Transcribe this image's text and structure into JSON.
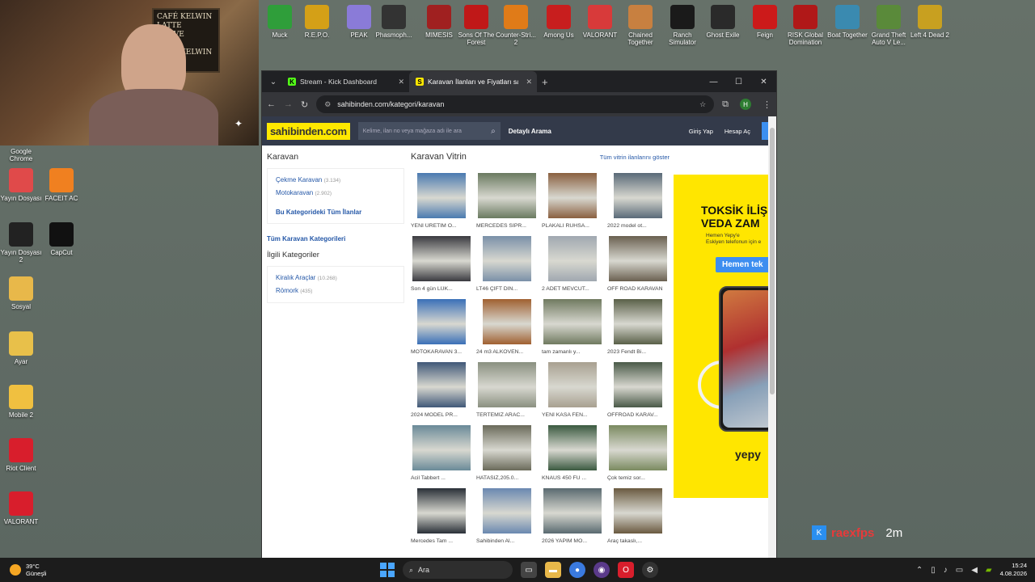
{
  "webcam": {
    "sign_text": "CAFÉ KELWIN\nLATTE\nKAHVE\nSIMIT\nCAFÉ KELWIN"
  },
  "desktop_top_icons": [
    {
      "label": "Muck",
      "color": "#2f9e3a"
    },
    {
      "label": "R.E.P.O.",
      "color": "#d4a017"
    },
    {
      "label": "PEAK",
      "color": "#8a7bd8"
    },
    {
      "label": "Phasmoph...",
      "color": "#333333"
    },
    {
      "label": "MIMESIS",
      "color": "#a02020"
    },
    {
      "label": "Sons Of The Forest",
      "color": "#c01818"
    },
    {
      "label": "Counter-Stri... 2",
      "color": "#e07b18"
    },
    {
      "label": "Among Us",
      "color": "#c81e1e"
    },
    {
      "label": "VALORANT",
      "color": "#d83a3a"
    },
    {
      "label": "Chained Together",
      "color": "#c88040"
    },
    {
      "label": "Ranch Simulator",
      "color": "#1a1a1a"
    },
    {
      "label": "Ghost Exile",
      "color": "#2a2a2a"
    },
    {
      "label": "Feign",
      "color": "#cc1a1a"
    },
    {
      "label": "RISK Global Domination",
      "color": "#b01818"
    },
    {
      "label": "Boat Together",
      "color": "#3a8ab0"
    },
    {
      "label": "Grand Theft Auto V Le...",
      "color": "#5a8a3a"
    },
    {
      "label": "Left 4 Dead 2",
      "color": "#c8a020"
    }
  ],
  "desktop_left_icons": [
    {
      "label": "Google Chrome",
      "color": "#3a7ae0"
    },
    {
      "label": "Yayın Dosyası",
      "color": "#e04a4a"
    },
    {
      "label": "FACEIT AC",
      "color": "#f08020"
    },
    {
      "label": "Yayın Dosyası 2",
      "color": "#222222"
    },
    {
      "label": "CapCut",
      "color": "#111111"
    },
    {
      "label": "Sosyal",
      "color": "#e8b84a"
    },
    {
      "label": "Ayar",
      "color": "#e8c04a"
    },
    {
      "label": "Mobile 2",
      "color": "#f0c040"
    },
    {
      "label": "Riot Client",
      "color": "#d81e2c"
    },
    {
      "label": "VALORANT",
      "color": "#d81e2c"
    }
  ],
  "browser": {
    "tabs": [
      {
        "title": "Stream - Kick Dashboard",
        "fav": "K",
        "fav_color": "#53fc18"
      },
      {
        "title": "Karavan İlanları ve Fiyatları sah",
        "fav": "S",
        "fav_color": "#ffe800"
      }
    ],
    "url": "sahibinden.com/kategori/karavan",
    "profile_initial": "H"
  },
  "site": {
    "logo": "sahibinden.com",
    "search_placeholder": "Kelime, ilan no veya mağaza adı ile ara",
    "detailed_search": "Detaylı Arama",
    "login": "Giriş Yap",
    "register": "Hesap Aç"
  },
  "left_panel": {
    "title": "Karavan",
    "items": [
      {
        "label": "Çekme Karavan",
        "count": "(3.134)"
      },
      {
        "label": "Motokaravan",
        "count": "(2.902)"
      }
    ],
    "all_link": "Bu Kategorideki Tüm İlanlar",
    "all_categories": "Tüm Karavan Kategorileri",
    "related_title": "İlgili Kategoriler",
    "related": [
      {
        "label": "Kiralık Araçlar",
        "count": "(10.268)"
      },
      {
        "label": "Römork",
        "count": "(435)"
      }
    ]
  },
  "vitrin": {
    "title": "Karavan Vitrin",
    "show_all": "Tüm vitrin ilanlarını göster",
    "listings": [
      {
        "caption": "YENİ ÜRETİM O...",
        "color": "#4a7ab0"
      },
      {
        "caption": "MERCEDES SİPR...",
        "color": "#6a7a60"
      },
      {
        "caption": "PLAKALI RUHSA...",
        "color": "#8a6040"
      },
      {
        "caption": "2022 model ot...",
        "color": "#5a6a78"
      },
      {
        "caption": "Son 4 gün LÜK...",
        "color": "#3a3a40"
      },
      {
        "caption": "LT46 ÇİFT DİN...",
        "color": "#7a90a8"
      },
      {
        "caption": "2 ADET MEVCUT...",
        "color": "#a0a8b0"
      },
      {
        "caption": "OFF ROAD KARAVAN",
        "color": "#6a6050"
      },
      {
        "caption": "MOTOKARAVAN 3...",
        "color": "#3a70b8"
      },
      {
        "caption": "24 m3 ALKOVEN...",
        "color": "#a06030"
      },
      {
        "caption": "tam zamanlı y...",
        "color": "#707a60"
      },
      {
        "caption": "2023 Fendt Bi...",
        "color": "#5a6048"
      },
      {
        "caption": "2024 MODEL PR...",
        "color": "#405878"
      },
      {
        "caption": "TERTEMİZ ARAC...",
        "color": "#8a9080"
      },
      {
        "caption": "YENİ KASA FEN...",
        "color": "#a8a090"
      },
      {
        "caption": "OFFROAD KARAV...",
        "color": "#4a5a48"
      },
      {
        "caption": "Acil Tabbert ...",
        "color": "#6a8a98"
      },
      {
        "caption": "HATASIZ,205.0...",
        "color": "#6a6a5a"
      },
      {
        "caption": "KNAUS 450 FU ...",
        "color": "#3a5a40"
      },
      {
        "caption": "Çok temiz sor...",
        "color": "#7a8a60"
      },
      {
        "caption": "Mercedes Tam ...",
        "color": "#2a3038"
      },
      {
        "caption": "Sahibinden Al...",
        "color": "#6a88b0"
      },
      {
        "caption": "2026 YAPIM MO...",
        "color": "#5a6a70"
      },
      {
        "caption": "Araç takaslı,...",
        "color": "#6a5a40"
      }
    ]
  },
  "ad": {
    "headline": "TOKSİK İLİŞ\nVEDA ZAM",
    "sub": "Hemen Yepy'e\nEskiyen telefonun için e",
    "button": "Hemen tek",
    "brand": "yepy"
  },
  "stream_overlay": {
    "name": "raexfps",
    "time": "2m"
  },
  "taskbar": {
    "temp": "39°C",
    "weather": "Güneşli",
    "search": "Ara",
    "time": "15:24",
    "date": "4.08.2026"
  }
}
